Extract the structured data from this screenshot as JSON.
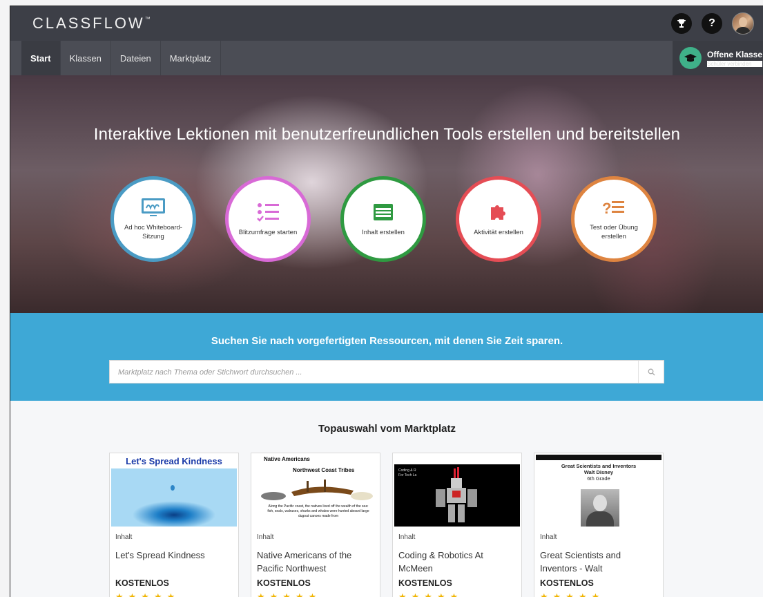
{
  "header": {
    "logo": "CLASSFLOW",
    "logo_tm": "™",
    "help_glyph": "?",
    "icons": [
      "trophy-icon",
      "help-icon",
      "avatar"
    ]
  },
  "nav": {
    "tabs": [
      {
        "label": "Start",
        "active": true
      },
      {
        "label": "Klassen",
        "active": false
      },
      {
        "label": "Dateien",
        "active": false
      },
      {
        "label": "Marktplatz",
        "active": false
      }
    ],
    "open_class": {
      "title": "Offene Klasse",
      "subtitle": "Schüler verbinden",
      "icon": "graduation-cap-icon"
    }
  },
  "hero": {
    "title": "Interaktive Lektionen mit benutzerfreundlichen Tools erstellen und bereitstellen",
    "actions": [
      {
        "label": "Ad hoc Whiteboard-Sitzung",
        "icon": "whiteboard-icon",
        "color": "#4a9bc4"
      },
      {
        "label": "Blitzumfrage starten",
        "icon": "poll-list-icon",
        "color": "#d86ad6"
      },
      {
        "label": "Inhalt erstellen",
        "icon": "content-icon",
        "color": "#2f9a41"
      },
      {
        "label": "Aktivität erstellen",
        "icon": "puzzle-icon",
        "color": "#e54d55"
      },
      {
        "label": "Test oder Übung erstellen",
        "icon": "quiz-icon",
        "color": "#de8440"
      }
    ]
  },
  "search": {
    "title": "Suchen Sie nach vorgefertigten Ressourcen, mit denen Sie Zeit sparen.",
    "placeholder": "Marktplatz nach Thema oder Stichwort durchsuchen ...",
    "band_color": "#3ea8d6"
  },
  "featured": {
    "title": "Topauswahl vom Marktplatz",
    "cards": [
      {
        "type": "Inhalt",
        "title": "Let's Spread Kindness",
        "price": "KOSTENLOS",
        "thumb_text": "Let's Spread Kindness",
        "stars": "★★★★★"
      },
      {
        "type": "Inhalt",
        "title": "Native Americans of the Pacific Northwest",
        "price": "KOSTENLOS",
        "thumb_text": "Native Americans",
        "thumb_sub": "Northwest Coast Tribes",
        "thumb_body": "Along the Pacific coast, the natives lived off the wealth of the sea: fish, seals, walruses, sharks and whales were hunted aboard large dugout canoes made from",
        "stars": "★★★★★"
      },
      {
        "type": "Inhalt",
        "title": "Coding & Robotics At McMeen",
        "price": "KOSTENLOS",
        "thumb_text": "Coding & R",
        "thumb_sub": "For Tech La",
        "stars": "★★★★★"
      },
      {
        "type": "Inhalt",
        "title": "Great Scientists and Inventors - Walt",
        "price": "KOSTENLOS",
        "thumb_text": "Great Scientists and Inventors",
        "thumb_sub": "Walt Disney",
        "thumb_sub2": "6th Grade",
        "stars": "★★★★★"
      }
    ]
  }
}
